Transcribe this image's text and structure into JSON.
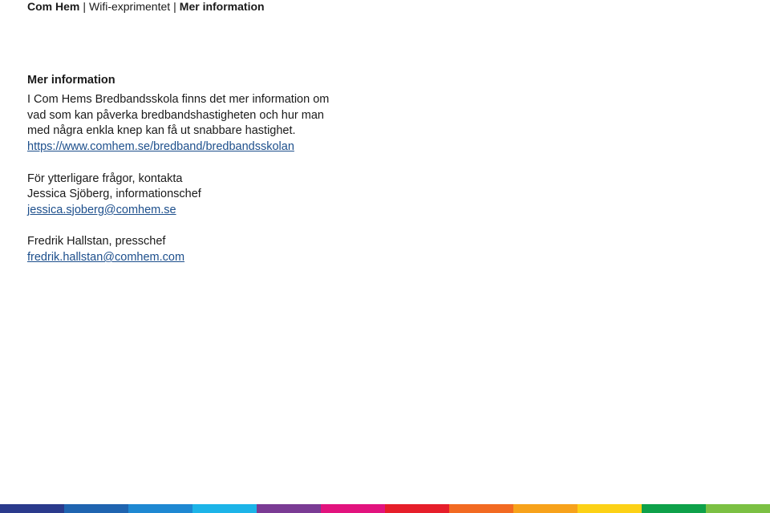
{
  "breadcrumb": {
    "home": "Com Hem",
    "separator": "|",
    "section": "Wifi-exprimentet",
    "current": "Mer information"
  },
  "content": {
    "heading": "Mer information",
    "intro": "I Com Hems Bredbandsskola finns det mer information om vad som kan påverka bredbandshastigheten och hur man med några enkla knep kan få ut snabbare hastighet.",
    "link": "https://www.comhem.se/bredband/bredbandsskolan",
    "contact_intro": "För ytterligare frågor, kontakta",
    "contacts": [
      {
        "name": "Jessica Sjöberg, informationschef",
        "email": "jessica.sjoberg@comhem.se"
      },
      {
        "name": "Fredrik Hallstan, presschef",
        "email": "fredrik.hallstan@comhem.com"
      }
    ]
  },
  "color_bar": [
    "#2a3a8c",
    "#1f64b0",
    "#1e88d2",
    "#1cb4e8",
    "#7a3b94",
    "#e2137e",
    "#e61e2a",
    "#f26a22",
    "#f7a21b",
    "#fcd116",
    "#0ea14a",
    "#7bc043"
  ]
}
